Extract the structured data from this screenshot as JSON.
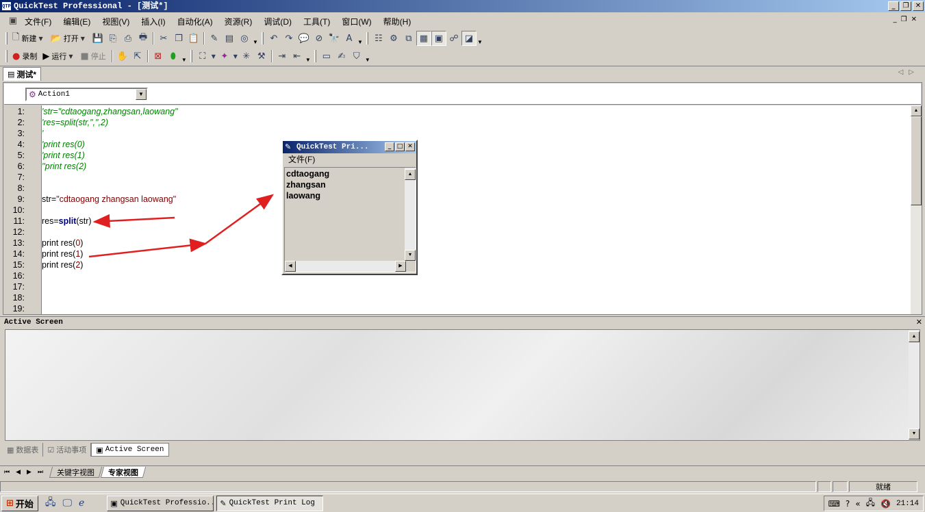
{
  "window": {
    "title": "QuickTest Professional - [测试*]",
    "app_icon": "QTP"
  },
  "menu": {
    "items": [
      "文件(F)",
      "编辑(E)",
      "视图(V)",
      "插入(I)",
      "自动化(A)",
      "资源(R)",
      "调试(D)",
      "工具(T)",
      "窗口(W)",
      "帮助(H)"
    ]
  },
  "toolbar1": {
    "new_label": "新建",
    "open_label": "打开"
  },
  "toolbar2": {
    "record_label": "录制",
    "run_label": "运行",
    "stop_label": "停止"
  },
  "doc_tab": {
    "label": "测试*"
  },
  "action_selector": {
    "value": "Action1"
  },
  "editor": {
    "line_numbers": [
      "1:",
      "2:",
      "3:",
      "4:",
      "5:",
      "6:",
      "7:",
      "8:",
      "9:",
      "10:",
      "11:",
      "12:",
      "13:",
      "14:",
      "15:",
      "16:",
      "17:",
      "18:",
      "19:"
    ],
    "lines": {
      "l1": "'str=\"cdtaogang,zhangsan,laowang\"",
      "l2": "'res=split(str,\",\",2)",
      "l3": "'",
      "l4": "'print res(0)",
      "l5": "'print res(1)",
      "l6": "''print res(2)",
      "l9_a": "str=",
      "l9_b": "\"cdtaogang zhangsan laowang\"",
      "l11_a": "res=",
      "l11_b": "split",
      "l11_c": "(str)",
      "l13_a": "print res(",
      "l13_b": "0",
      "l13_c": ")",
      "l14_a": "print res(",
      "l14_b": "1",
      "l14_c": ")",
      "l15_a": "print res(",
      "l15_b": "2",
      "l15_c": ")"
    }
  },
  "print_log": {
    "title": "QuickTest Pri...",
    "menu_label": "文件(F)",
    "lines": [
      "cdtaogang",
      "zhangsan",
      "laowang"
    ]
  },
  "active_screen": {
    "title": "Active Screen"
  },
  "bottom_tabs": [
    "数据表",
    "活动事项",
    "Active Screen"
  ],
  "view_tabs": [
    "关键字视图",
    "专家视图"
  ],
  "status": {
    "text": "就绪"
  },
  "taskbar": {
    "start_label": "开始",
    "tasks": [
      "QuickTest Professio...",
      "QuickTest Print Log"
    ],
    "clock": "21:14"
  },
  "colors": {
    "comment": "#008000",
    "string": "#800000",
    "keyword": "#000080",
    "arrow": "#e02020"
  }
}
